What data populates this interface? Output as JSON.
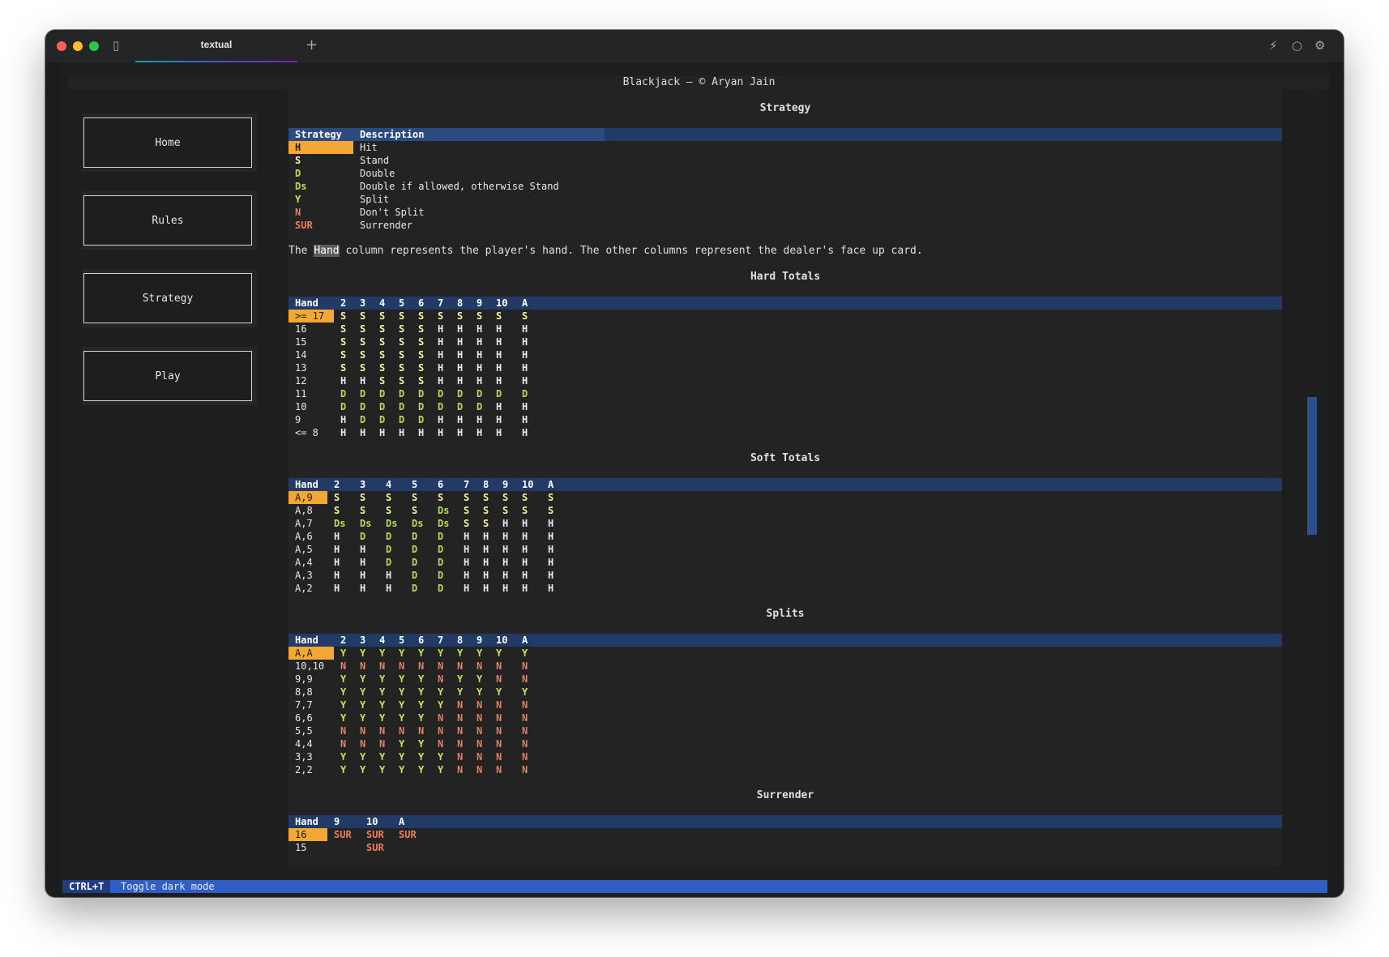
{
  "window": {
    "tab_title": "textual"
  },
  "header": {
    "title": "Blackjack — © Aryan Jain"
  },
  "nav": [
    "Home",
    "Rules",
    "Strategy",
    "Play"
  ],
  "strategy_section": {
    "title": "Strategy",
    "headers": [
      "Strategy",
      "Description"
    ],
    "rows": [
      [
        "H",
        "Hit"
      ],
      [
        "S",
        "Stand"
      ],
      [
        "D",
        "Double"
      ],
      [
        "Ds",
        "Double if allowed, otherwise Stand"
      ],
      [
        "Y",
        "Split"
      ],
      [
        "N",
        "Don't Split"
      ],
      [
        "SUR",
        "Surrender"
      ]
    ]
  },
  "explanation": {
    "before": "The ",
    "keyword": "Hand",
    "after": " column represents the player's hand. The other columns represent the dealer's face up card."
  },
  "hard_totals": {
    "title": "Hard Totals",
    "headers": [
      "Hand",
      "2",
      "3",
      "4",
      "5",
      "6",
      "7",
      "8",
      "9",
      "10",
      "A"
    ],
    "rows": [
      [
        ">= 17",
        "S",
        "S",
        "S",
        "S",
        "S",
        "S",
        "S",
        "S",
        "S",
        "S"
      ],
      [
        "16",
        "S",
        "S",
        "S",
        "S",
        "S",
        "H",
        "H",
        "H",
        "H",
        "H"
      ],
      [
        "15",
        "S",
        "S",
        "S",
        "S",
        "S",
        "H",
        "H",
        "H",
        "H",
        "H"
      ],
      [
        "14",
        "S",
        "S",
        "S",
        "S",
        "S",
        "H",
        "H",
        "H",
        "H",
        "H"
      ],
      [
        "13",
        "S",
        "S",
        "S",
        "S",
        "S",
        "H",
        "H",
        "H",
        "H",
        "H"
      ],
      [
        "12",
        "H",
        "H",
        "S",
        "S",
        "S",
        "H",
        "H",
        "H",
        "H",
        "H"
      ],
      [
        "11",
        "D",
        "D",
        "D",
        "D",
        "D",
        "D",
        "D",
        "D",
        "D",
        "D"
      ],
      [
        "10",
        "D",
        "D",
        "D",
        "D",
        "D",
        "D",
        "D",
        "D",
        "H",
        "H"
      ],
      [
        "9",
        "H",
        "D",
        "D",
        "D",
        "D",
        "H",
        "H",
        "H",
        "H",
        "H"
      ],
      [
        "<= 8",
        "H",
        "H",
        "H",
        "H",
        "H",
        "H",
        "H",
        "H",
        "H",
        "H"
      ]
    ]
  },
  "soft_totals": {
    "title": "Soft Totals",
    "headers": [
      "Hand",
      "2",
      "3",
      "4",
      "5",
      "6",
      "7",
      "8",
      "9",
      "10",
      "A"
    ],
    "rows": [
      [
        "A,9",
        "S",
        "S",
        "S",
        "S",
        "S",
        "S",
        "S",
        "S",
        "S",
        "S"
      ],
      [
        "A,8",
        "S",
        "S",
        "S",
        "S",
        "Ds",
        "S",
        "S",
        "S",
        "S",
        "S"
      ],
      [
        "A,7",
        "Ds",
        "Ds",
        "Ds",
        "Ds",
        "Ds",
        "S",
        "S",
        "H",
        "H",
        "H"
      ],
      [
        "A,6",
        "H",
        "D",
        "D",
        "D",
        "D",
        "H",
        "H",
        "H",
        "H",
        "H"
      ],
      [
        "A,5",
        "H",
        "H",
        "D",
        "D",
        "D",
        "H",
        "H",
        "H",
        "H",
        "H"
      ],
      [
        "A,4",
        "H",
        "H",
        "D",
        "D",
        "D",
        "H",
        "H",
        "H",
        "H",
        "H"
      ],
      [
        "A,3",
        "H",
        "H",
        "H",
        "D",
        "D",
        "H",
        "H",
        "H",
        "H",
        "H"
      ],
      [
        "A,2",
        "H",
        "H",
        "H",
        "D",
        "D",
        "H",
        "H",
        "H",
        "H",
        "H"
      ]
    ]
  },
  "splits": {
    "title": "Splits",
    "headers": [
      "Hand",
      "2",
      "3",
      "4",
      "5",
      "6",
      "7",
      "8",
      "9",
      "10",
      "A"
    ],
    "rows": [
      [
        "A,A",
        "Y",
        "Y",
        "Y",
        "Y",
        "Y",
        "Y",
        "Y",
        "Y",
        "Y",
        "Y"
      ],
      [
        "10,10",
        "N",
        "N",
        "N",
        "N",
        "N",
        "N",
        "N",
        "N",
        "N",
        "N"
      ],
      [
        "9,9",
        "Y",
        "Y",
        "Y",
        "Y",
        "Y",
        "N",
        "Y",
        "Y",
        "N",
        "N"
      ],
      [
        "8,8",
        "Y",
        "Y",
        "Y",
        "Y",
        "Y",
        "Y",
        "Y",
        "Y",
        "Y",
        "Y"
      ],
      [
        "7,7",
        "Y",
        "Y",
        "Y",
        "Y",
        "Y",
        "Y",
        "N",
        "N",
        "N",
        "N"
      ],
      [
        "6,6",
        "Y",
        "Y",
        "Y",
        "Y",
        "Y",
        "N",
        "N",
        "N",
        "N",
        "N"
      ],
      [
        "5,5",
        "N",
        "N",
        "N",
        "N",
        "N",
        "N",
        "N",
        "N",
        "N",
        "N"
      ],
      [
        "4,4",
        "N",
        "N",
        "N",
        "Y",
        "Y",
        "N",
        "N",
        "N",
        "N",
        "N"
      ],
      [
        "3,3",
        "Y",
        "Y",
        "Y",
        "Y",
        "Y",
        "Y",
        "N",
        "N",
        "N",
        "N"
      ],
      [
        "2,2",
        "Y",
        "Y",
        "Y",
        "Y",
        "Y",
        "Y",
        "N",
        "N",
        "N",
        "N"
      ]
    ]
  },
  "surrender": {
    "title": "Surrender",
    "headers": [
      "Hand",
      "9",
      "10",
      "A"
    ],
    "rows": [
      [
        "16",
        "SUR",
        "SUR",
        "SUR"
      ],
      [
        "15",
        "",
        "SUR",
        ""
      ]
    ]
  },
  "footer": {
    "key": "CTRL+T",
    "description": "Toggle dark mode"
  },
  "colors": {
    "accent": "#f4a734",
    "header_row": "#213b66",
    "status_bar": "#2f5fc4",
    "stand": "#f7f1a0",
    "double": "#b4df53",
    "no": "#f07c5a"
  }
}
